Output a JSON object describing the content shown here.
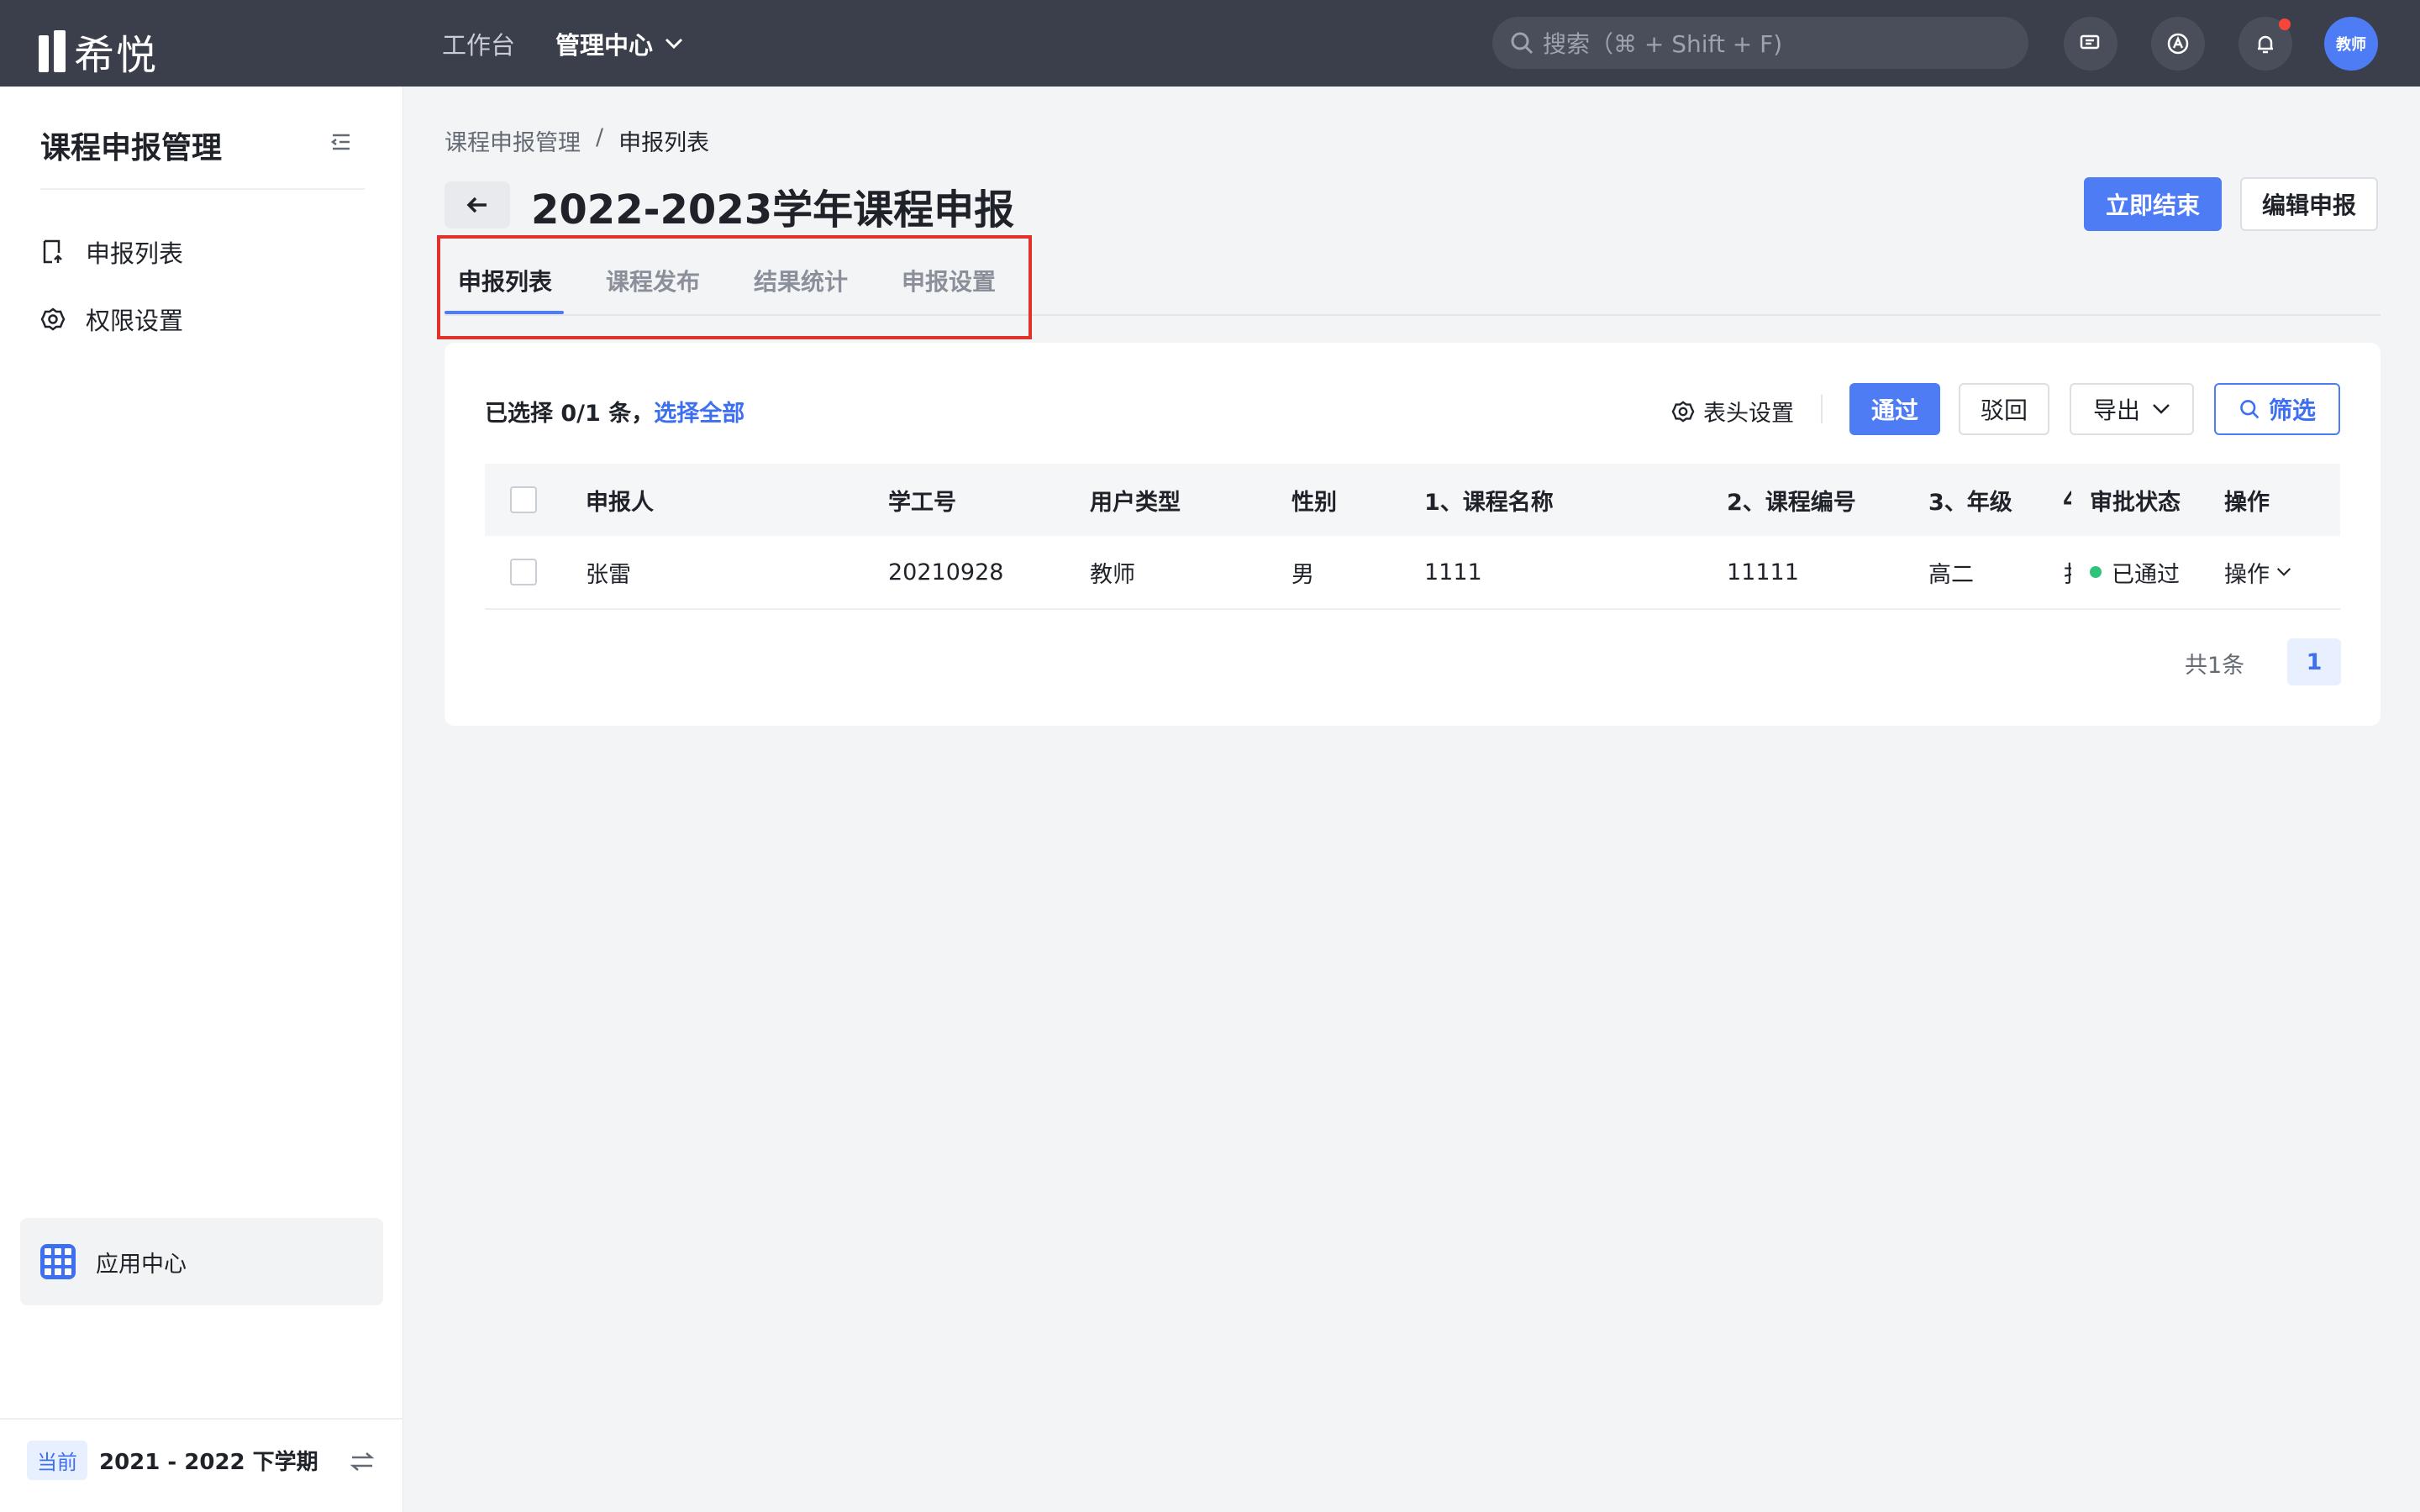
{
  "app": {
    "logo_text": "希悦"
  },
  "topnav": {
    "workbench": "工作台",
    "admin_center": "管理中心",
    "search_placeholder": "搜索（⌘ + Shift + F)",
    "avatar_label": "教师"
  },
  "sidebar": {
    "title": "课程申报管理",
    "items": [
      {
        "label": "申报列表",
        "icon": "document-upload-icon"
      },
      {
        "label": "权限设置",
        "icon": "gear-icon"
      }
    ],
    "app_center": "应用中心",
    "term_badge": "当前",
    "term_text": "2021 - 2022 下学期"
  },
  "breadcrumb": {
    "parent": "课程申报管理",
    "separator": "/",
    "current": "申报列表"
  },
  "page": {
    "title": "2022-2023学年课程申报",
    "end_now": "立即结束",
    "edit": "编辑申报"
  },
  "tabs": [
    "申报列表",
    "课程发布",
    "结果统计",
    "申报设置"
  ],
  "toolbar": {
    "selected_prefix": "已选择 0/1 条，",
    "select_all": "选择全部",
    "column_settings": "表头设置",
    "approve": "通过",
    "reject": "驳回",
    "export": "导出",
    "filter": "筛选"
  },
  "table": {
    "headers": [
      "申报人",
      "学工号",
      "用户类型",
      "性别",
      "1、课程名称",
      "2、课程编号",
      "3、年级",
      "4",
      "审批状态",
      "操作"
    ],
    "rows": [
      {
        "name": "张雷",
        "id": "20210928",
        "user_type": "教师",
        "gender": "男",
        "course_name": "1111",
        "course_code": "11111",
        "grade": "高二",
        "col4": "扌",
        "status": "已通过",
        "action": "操作"
      }
    ]
  },
  "pagination": {
    "total": "共1条",
    "current_page": "1"
  },
  "colors": {
    "primary": "#4d7cf5",
    "topbar": "#3b3f4b",
    "status_approved": "#2fc27a",
    "highlight": "#e0312b"
  }
}
